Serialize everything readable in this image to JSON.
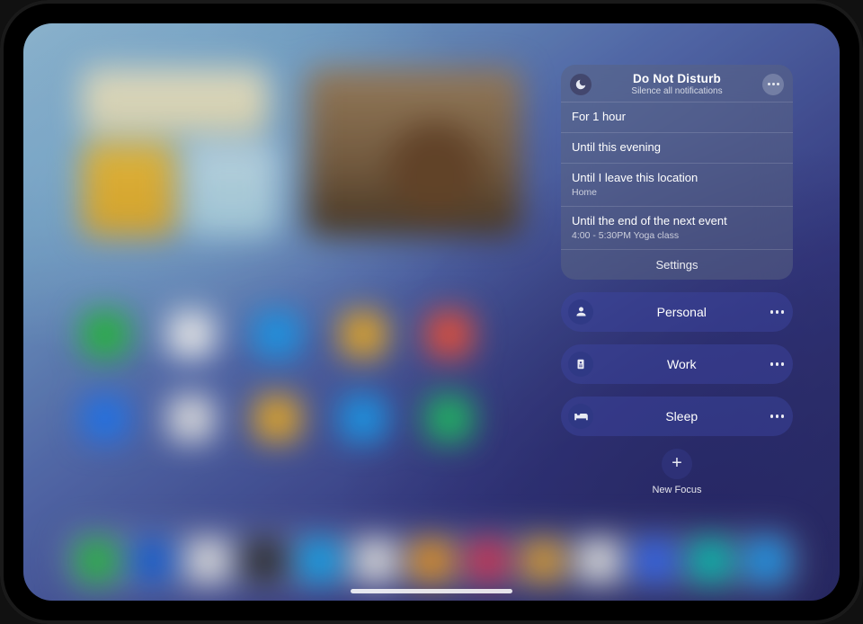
{
  "dnd": {
    "title": "Do Not Disturb",
    "subtitle": "Silence all notifications",
    "options": [
      {
        "label": "For 1 hour"
      },
      {
        "label": "Until this evening"
      },
      {
        "label": "Until I leave this location",
        "detail": "Home"
      },
      {
        "label": "Until the end of the next event",
        "detail": "4:00 - 5:30PM Yoga class"
      }
    ],
    "settings_label": "Settings"
  },
  "focus_modes": [
    {
      "icon": "person-icon",
      "label": "Personal"
    },
    {
      "icon": "badge-icon",
      "label": "Work"
    },
    {
      "icon": "bed-icon",
      "label": "Sleep"
    }
  ],
  "new_focus": {
    "label": "New Focus"
  },
  "bg_icons": {
    "row1": [
      "#37c24d",
      "#ffffff",
      "#2aa2f0",
      "#f2b63b",
      "#ec5a46"
    ],
    "row2": [
      "#2e7ef0",
      "#f0f0f2",
      "#f2b63b",
      "#2aa2f0",
      "#30c270"
    ],
    "dock": [
      "#35c24d",
      "#1e66d6",
      "#f3f3f3",
      "#333333",
      "#1eaef3",
      "#f0f0f0",
      "#f0a030",
      "#d33b5a",
      "#e5a740",
      "#f3f3f3",
      "#3b6cf0",
      "#14c7b8",
      "#2aa2f0"
    ]
  }
}
